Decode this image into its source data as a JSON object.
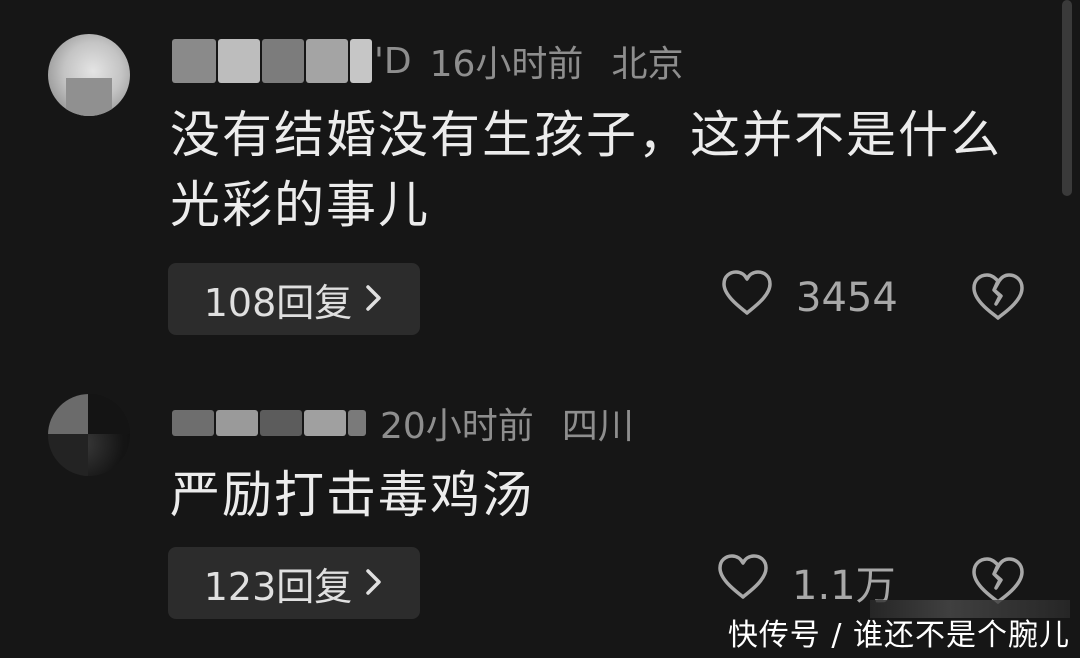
{
  "comments": [
    {
      "username_suffix": "'D",
      "time": "16小时前",
      "location": "北京",
      "text": "没有结婚没有生孩子，这并不是什么光彩的事儿",
      "reply_label": "108回复",
      "likes": "3454"
    },
    {
      "username_suffix": "",
      "time": "20小时前",
      "location": "四川",
      "text": "严励打击毒鸡汤",
      "reply_label": "123回复",
      "likes": "1.1万"
    }
  ],
  "icons": {
    "chevron": "chevron-right-icon",
    "like": "heart-outline-icon",
    "dislike": "broken-heart-icon"
  },
  "watermark": "快传号 / 谁还不是个腕儿",
  "colors": {
    "background": "#161616",
    "text_primary": "#ececec",
    "text_meta": "#8e8e8e",
    "reply_bg": "#2c2c2c"
  }
}
